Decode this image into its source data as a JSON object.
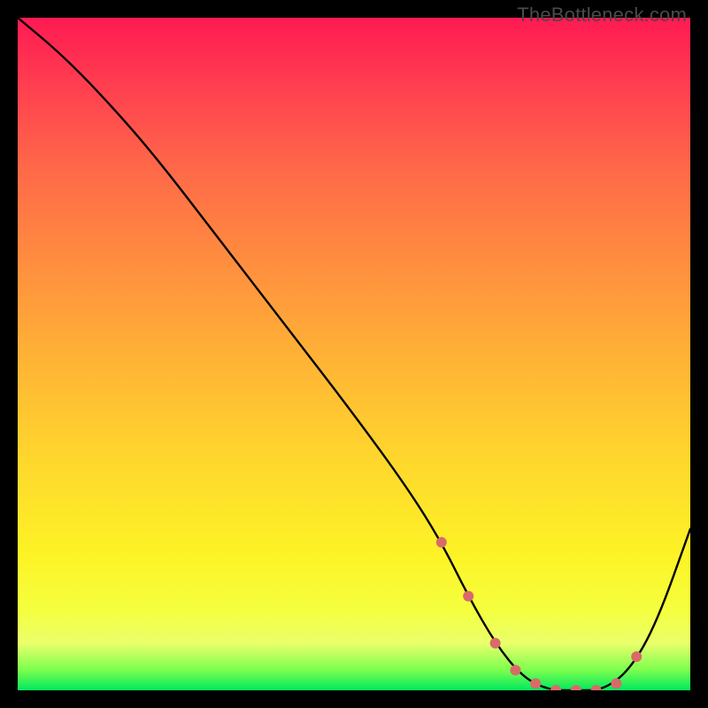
{
  "watermark": "TheBottleneck.com",
  "chart_data": {
    "type": "line",
    "title": "",
    "xlabel": "",
    "ylabel": "",
    "xlim": [
      0,
      100
    ],
    "ylim": [
      0,
      100
    ],
    "series": [
      {
        "name": "bottleneck-curve",
        "x": [
          0,
          6,
          12,
          20,
          30,
          40,
          50,
          58,
          63,
          67,
          71,
          75,
          79,
          83,
          87,
          91,
          95,
          100
        ],
        "y": [
          100,
          95,
          89,
          80,
          67,
          54,
          41,
          30,
          22,
          14,
          7,
          2,
          0,
          0,
          0,
          3,
          10,
          24
        ],
        "color": "#000000"
      }
    ],
    "markers": {
      "name": "highlight-dots",
      "color": "#d96a6a",
      "x": [
        63,
        67,
        71,
        74,
        77,
        80,
        83,
        86,
        89,
        92
      ],
      "y": [
        22,
        14,
        7,
        3,
        1,
        0,
        0,
        0,
        1,
        5
      ]
    },
    "gradient_bands": [
      {
        "pos": 0.0,
        "color": "#ff1a52"
      },
      {
        "pos": 0.5,
        "color": "#ffb136"
      },
      {
        "pos": 0.8,
        "color": "#fdf326"
      },
      {
        "pos": 1.0,
        "color": "#00e85e"
      }
    ]
  }
}
